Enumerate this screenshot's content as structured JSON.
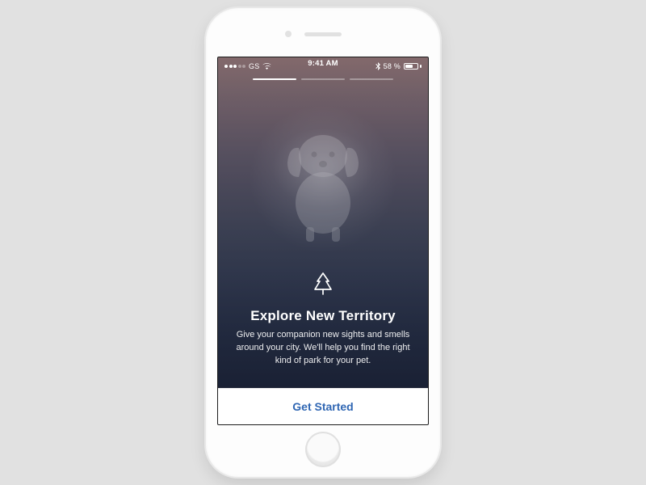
{
  "status": {
    "signal_filled": 3,
    "signal_total": 5,
    "carrier": "GS",
    "time": "9:41 AM",
    "battery_text": "58 %",
    "battery_level": 0.58
  },
  "progress": {
    "current": 1,
    "total": 3
  },
  "onboarding": {
    "icon_name": "tree-icon",
    "title": "Explore New Territory",
    "body": "Give your companion new sights and smells around your city. We'll help you find the right kind of park for your pet."
  },
  "cta": {
    "label": "Get Started"
  },
  "colors": {
    "cta_text": "#2f66b3"
  }
}
